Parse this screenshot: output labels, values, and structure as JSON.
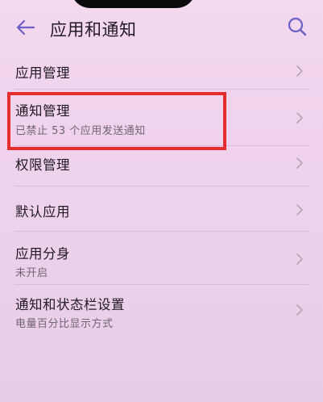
{
  "header": {
    "title": "应用和通知",
    "back_icon": "back-arrow-icon",
    "search_icon": "search-icon"
  },
  "items": [
    {
      "label": "应用管理"
    },
    {
      "label": "通知管理",
      "subtitle": "已禁止 53 个应用发送通知",
      "highlighted": true
    },
    {
      "label": "权限管理"
    },
    {
      "label": "默认应用"
    },
    {
      "label": "应用分身",
      "subtitle": "未开启"
    },
    {
      "label": "通知和状态栏设置",
      "subtitle": "电量百分比显示方式"
    }
  ],
  "colors": {
    "background": "#f0d2ec",
    "accent": "#6a5fc7",
    "highlight": "#e62c2f"
  }
}
